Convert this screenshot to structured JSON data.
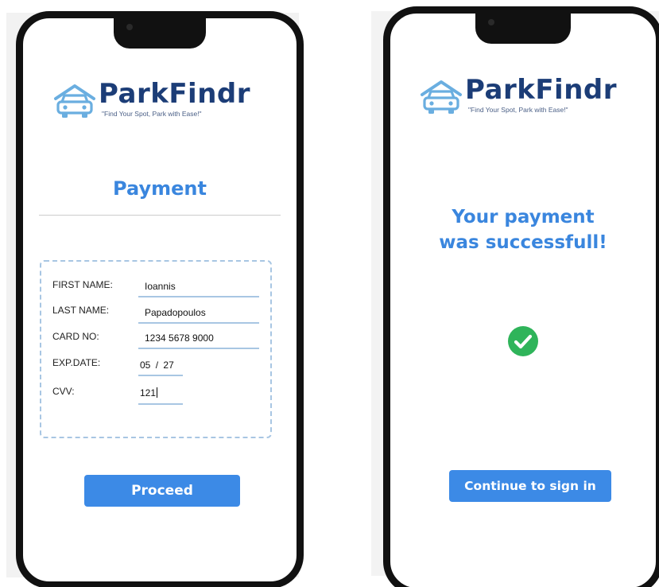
{
  "brand": {
    "name": "ParkFindr",
    "tagline": "\"Find Your Spot, Park with Ease!\"",
    "accent_color": "#3a86de",
    "logo_text_color": "#1c3d77"
  },
  "payment_screen": {
    "title": "Payment",
    "fields": {
      "first_name": {
        "label": "FIRST NAME:",
        "value": "Ioannis"
      },
      "last_name": {
        "label": "LAST NAME:",
        "value": "Papadopoulos"
      },
      "card_no": {
        "label": "CARD NO:",
        "value": "1234 5678 9000"
      },
      "exp_date": {
        "label": "EXP.DATE:",
        "month": "05",
        "separator": "/",
        "year": "27"
      },
      "cvv": {
        "label": "CVV:",
        "value": "121"
      }
    },
    "proceed_label": "Proceed"
  },
  "success_screen": {
    "line1": "Your payment",
    "line2": "was successfull!",
    "status_icon": "check-circle-icon",
    "status_color": "#2fb45a",
    "continue_label": "Continue to sign in"
  }
}
